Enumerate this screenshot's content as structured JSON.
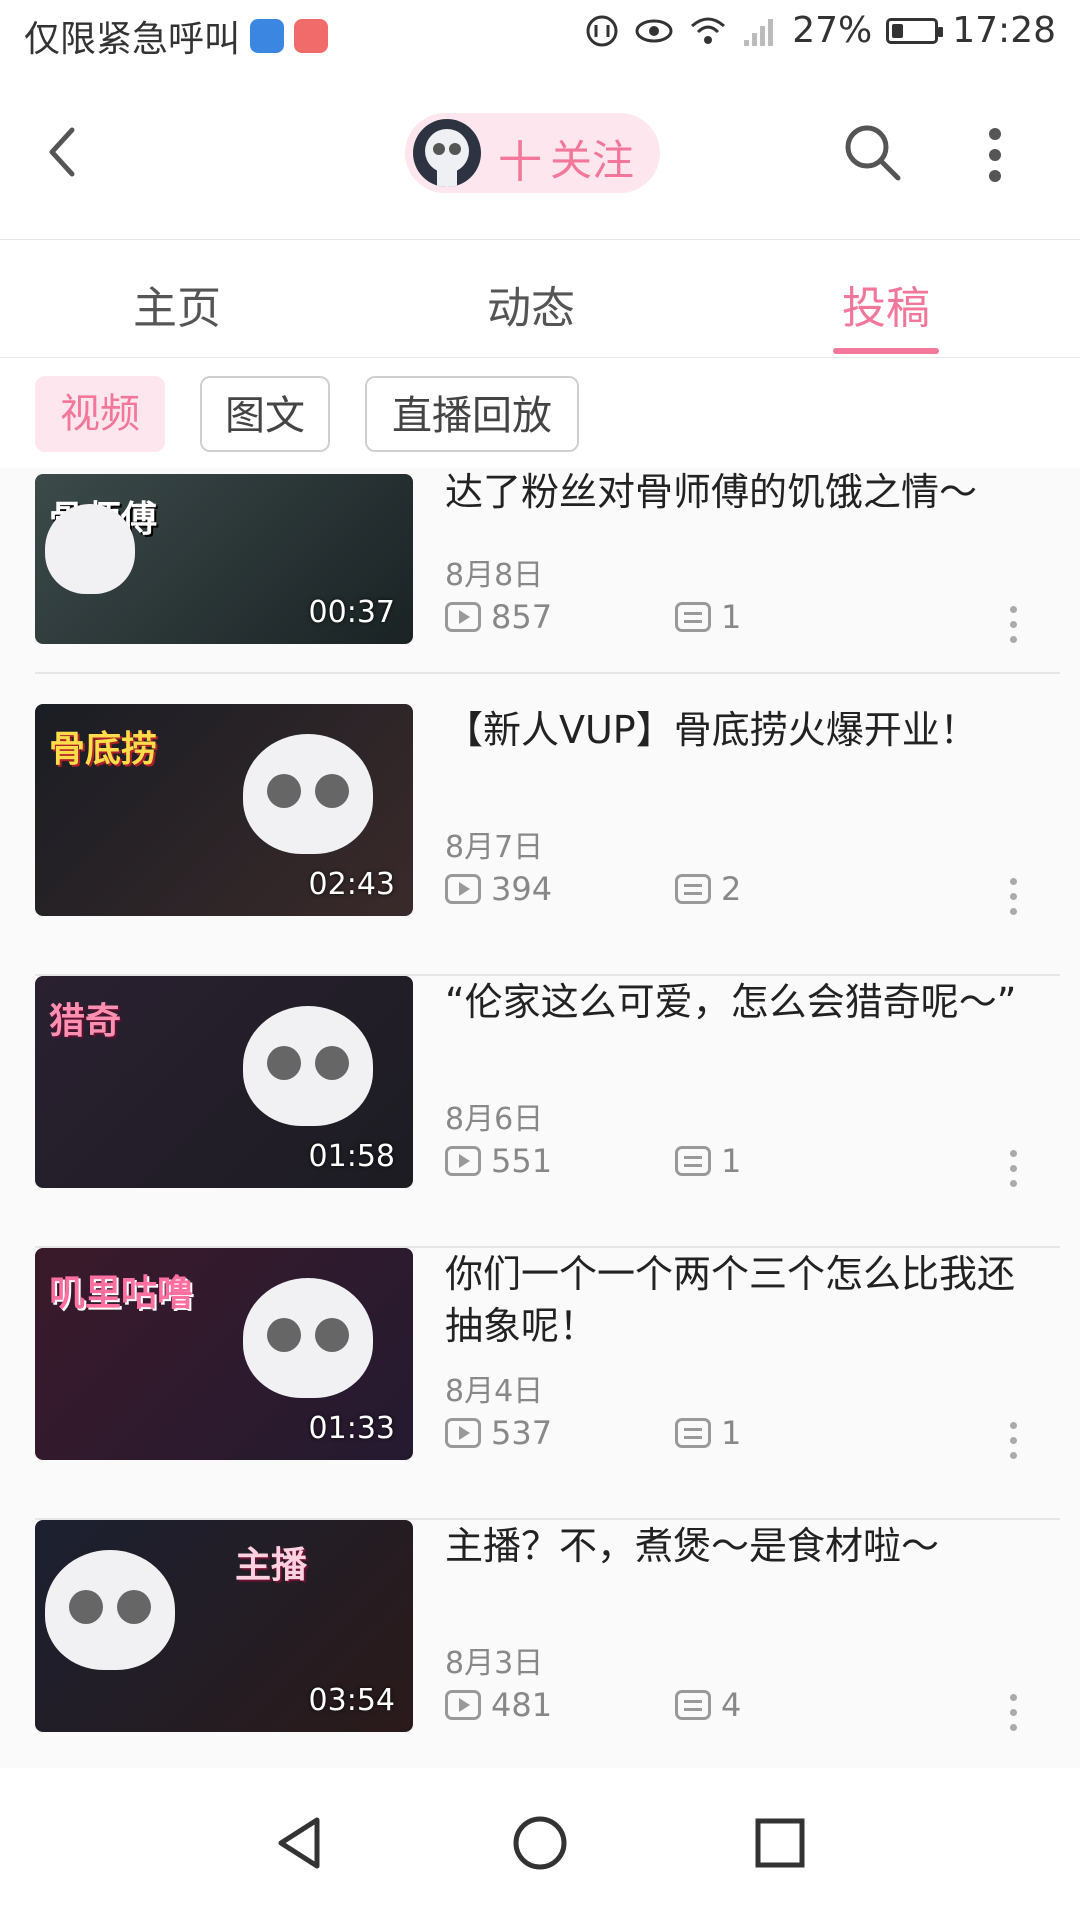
{
  "status_bar": {
    "left_text": "仅限紧急呼叫",
    "battery": "27%",
    "battery_fraction": 0.27,
    "time": "17:28"
  },
  "header": {
    "follow_plus": "十",
    "follow_label": "关注"
  },
  "tabs": [
    {
      "label": "主页",
      "active": false
    },
    {
      "label": "动态",
      "active": false
    },
    {
      "label": "投稿",
      "active": true
    }
  ],
  "filters": [
    {
      "label": "视频",
      "active": true
    },
    {
      "label": "图文",
      "active": false
    },
    {
      "label": "直播回放",
      "active": false
    }
  ],
  "videos": [
    {
      "thumb_text": "骨师傅",
      "duration": "00:37",
      "title": "达了粉丝对骨师傅的饥饿之情～",
      "date": "8月8日",
      "views": "857",
      "comments": "1"
    },
    {
      "thumb_text": "骨底捞",
      "duration": "02:43",
      "title": "【新人VUP】骨底捞火爆开业！",
      "date": "8月7日",
      "views": "394",
      "comments": "2"
    },
    {
      "thumb_text": "猎奇",
      "duration": "01:58",
      "title": "“伦家这么可爱，怎么会猎奇呢～”",
      "date": "8月6日",
      "views": "551",
      "comments": "1"
    },
    {
      "thumb_text": "叽里咕噜",
      "duration": "01:33",
      "title": "你们一个一个两个三个怎么比我还抽象呢！",
      "date": "8月4日",
      "views": "537",
      "comments": "1"
    },
    {
      "thumb_text": "主播",
      "duration": "03:54",
      "title": "主播？不，煮煲～是食材啦～",
      "date": "8月3日",
      "views": "481",
      "comments": "4"
    }
  ],
  "colors": {
    "accent": "#f2779a",
    "accent_bg": "#fde6ee"
  }
}
